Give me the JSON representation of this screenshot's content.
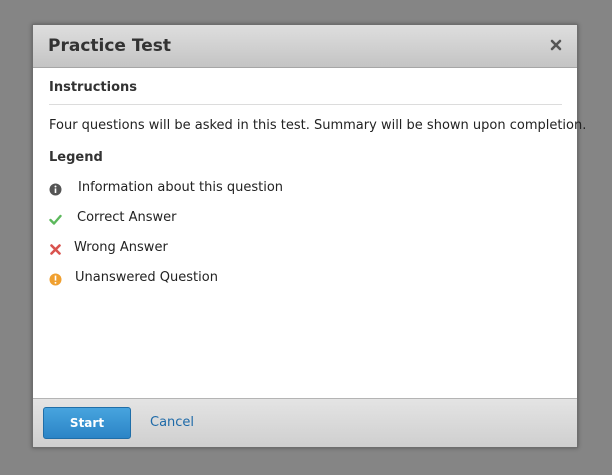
{
  "dialog": {
    "title": "Practice Test",
    "close_icon": "close-icon"
  },
  "instructions": {
    "heading": "Instructions",
    "text": "Four questions will be asked in this test. Summary will be shown upon completion."
  },
  "legend": {
    "heading": "Legend",
    "items": [
      {
        "icon": "info-icon",
        "label": "Information about this question",
        "color": "#555555"
      },
      {
        "icon": "check-icon",
        "label": "Correct Answer",
        "color": "#5cb85c"
      },
      {
        "icon": "cross-icon",
        "label": "Wrong Answer",
        "color": "#d9534f"
      },
      {
        "icon": "exclamation-icon",
        "label": "Unanswered Question",
        "color": "#f0a030"
      }
    ]
  },
  "footer": {
    "start_label": "Start",
    "cancel_label": "Cancel"
  },
  "colors": {
    "overlay": "#858585",
    "primary_button": "#2f8ccf",
    "link": "#1e6aa8"
  }
}
